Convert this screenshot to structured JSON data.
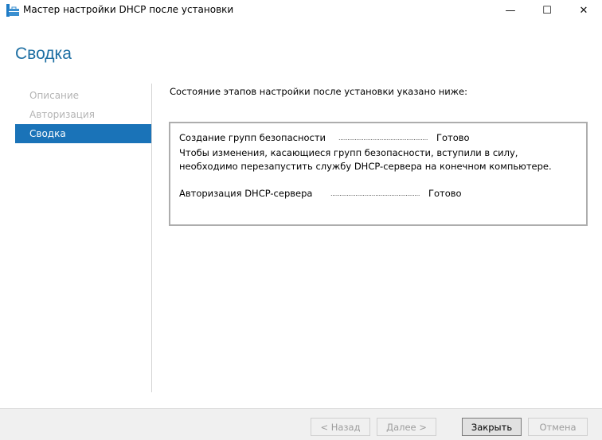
{
  "window": {
    "title": "Мастер настройки DHCP после установки",
    "minimize": "—",
    "maximize": "☐",
    "close": "✕"
  },
  "heading": "Сводка",
  "nav": [
    {
      "label": "Описание"
    },
    {
      "label": "Авторизация"
    },
    {
      "label": "Сводка",
      "active": true
    }
  ],
  "intro": "Состояние этапов настройки после установки указано ниже:",
  "steps": [
    {
      "label": "Создание групп безопасности",
      "dots": "........................................................",
      "status": "Готово",
      "note": "Чтобы изменения, касающиеся групп безопасности, вступили в силу, необходимо перезапустить службу DHCP-сервера на конечном компьютере."
    },
    {
      "label": "Авторизация DHCP-сервера",
      "dots": "........................................................",
      "status": "Готово"
    }
  ],
  "buttons": {
    "back": "< Назад",
    "next": "Далее >",
    "close": "Закрыть",
    "cancel": "Отмена"
  }
}
